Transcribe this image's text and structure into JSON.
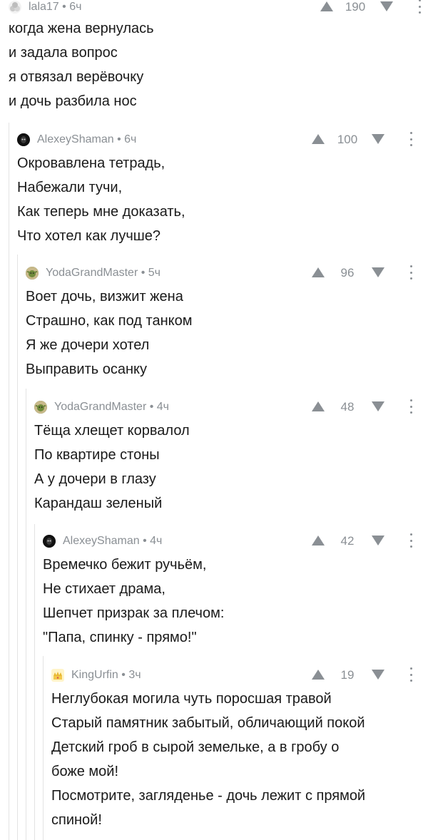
{
  "comments": [
    {
      "author": "lala17",
      "time": "6ч",
      "rating": "190",
      "avatar": "avatar-lala17",
      "lines": [
        "когда жена вернулась",
        "и задала вопрос",
        "я отвязал верёвочку",
        "и дочь разбила нос"
      ]
    },
    {
      "author": "AlexeyShaman",
      "time": "6ч",
      "rating": "100",
      "avatar": "avatar-alexeyshaman",
      "lines": [
        "Окровавлена тетрадь,",
        "Набежали тучи,",
        "Как теперь мне доказать,",
        "Что хотел как лучше?"
      ]
    },
    {
      "author": "YodaGrandMaster",
      "time": "5ч",
      "rating": "96",
      "avatar": "avatar-yodagrandmaster",
      "lines": [
        "Воет дочь, визжит жена",
        "Страшно, как под танком",
        "Я же дочери хотел",
        "Выправить осанку"
      ]
    },
    {
      "author": "YodaGrandMaster",
      "time": "4ч",
      "rating": "48",
      "avatar": "avatar-yodagrandmaster",
      "lines": [
        "Тёща хлещет корвалол",
        "По квартире стоны",
        "А у дочери в глазу",
        "Карандаш зеленый"
      ]
    },
    {
      "author": "AlexeyShaman",
      "time": "4ч",
      "rating": "42",
      "avatar": "avatar-alexeyshaman",
      "lines": [
        "Времечко бежит ручьём,",
        "Не стихает драма,",
        "Шепчет призрак за плечом:",
        "\"Папа, спинку - прямо!\""
      ]
    },
    {
      "author": "KingUrfin",
      "time": "3ч",
      "rating": "19",
      "avatar": "avatar-kingurfin",
      "lines": [
        "Неглубокая могила чуть поросшая травой",
        "Старый памятник забытый, обличающий покой",
        "Детский гроб в сырой земельке, а в гробу о",
        "боже мой!",
        "Посмотрите, загляденье - дочь лежит с прямой",
        "спиной!"
      ]
    }
  ],
  "colors": {
    "meta": "#8a8f94",
    "text": "#1a1a1a",
    "thread_line": "#e3e3e3"
  }
}
